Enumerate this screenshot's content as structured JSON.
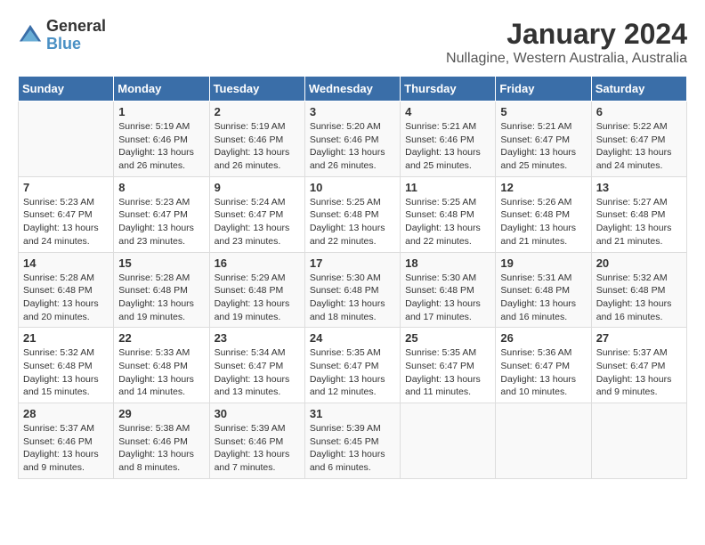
{
  "logo": {
    "text_general": "General",
    "text_blue": "Blue"
  },
  "title": "January 2024",
  "subtitle": "Nullagine, Western Australia, Australia",
  "days_of_week": [
    "Sunday",
    "Monday",
    "Tuesday",
    "Wednesday",
    "Thursday",
    "Friday",
    "Saturday"
  ],
  "weeks": [
    [
      {
        "num": "",
        "detail": ""
      },
      {
        "num": "1",
        "detail": "Sunrise: 5:19 AM\nSunset: 6:46 PM\nDaylight: 13 hours\nand 26 minutes."
      },
      {
        "num": "2",
        "detail": "Sunrise: 5:19 AM\nSunset: 6:46 PM\nDaylight: 13 hours\nand 26 minutes."
      },
      {
        "num": "3",
        "detail": "Sunrise: 5:20 AM\nSunset: 6:46 PM\nDaylight: 13 hours\nand 26 minutes."
      },
      {
        "num": "4",
        "detail": "Sunrise: 5:21 AM\nSunset: 6:46 PM\nDaylight: 13 hours\nand 25 minutes."
      },
      {
        "num": "5",
        "detail": "Sunrise: 5:21 AM\nSunset: 6:47 PM\nDaylight: 13 hours\nand 25 minutes."
      },
      {
        "num": "6",
        "detail": "Sunrise: 5:22 AM\nSunset: 6:47 PM\nDaylight: 13 hours\nand 24 minutes."
      }
    ],
    [
      {
        "num": "7",
        "detail": "Sunrise: 5:23 AM\nSunset: 6:47 PM\nDaylight: 13 hours\nand 24 minutes."
      },
      {
        "num": "8",
        "detail": "Sunrise: 5:23 AM\nSunset: 6:47 PM\nDaylight: 13 hours\nand 23 minutes."
      },
      {
        "num": "9",
        "detail": "Sunrise: 5:24 AM\nSunset: 6:47 PM\nDaylight: 13 hours\nand 23 minutes."
      },
      {
        "num": "10",
        "detail": "Sunrise: 5:25 AM\nSunset: 6:48 PM\nDaylight: 13 hours\nand 22 minutes."
      },
      {
        "num": "11",
        "detail": "Sunrise: 5:25 AM\nSunset: 6:48 PM\nDaylight: 13 hours\nand 22 minutes."
      },
      {
        "num": "12",
        "detail": "Sunrise: 5:26 AM\nSunset: 6:48 PM\nDaylight: 13 hours\nand 21 minutes."
      },
      {
        "num": "13",
        "detail": "Sunrise: 5:27 AM\nSunset: 6:48 PM\nDaylight: 13 hours\nand 21 minutes."
      }
    ],
    [
      {
        "num": "14",
        "detail": "Sunrise: 5:28 AM\nSunset: 6:48 PM\nDaylight: 13 hours\nand 20 minutes."
      },
      {
        "num": "15",
        "detail": "Sunrise: 5:28 AM\nSunset: 6:48 PM\nDaylight: 13 hours\nand 19 minutes."
      },
      {
        "num": "16",
        "detail": "Sunrise: 5:29 AM\nSunset: 6:48 PM\nDaylight: 13 hours\nand 19 minutes."
      },
      {
        "num": "17",
        "detail": "Sunrise: 5:30 AM\nSunset: 6:48 PM\nDaylight: 13 hours\nand 18 minutes."
      },
      {
        "num": "18",
        "detail": "Sunrise: 5:30 AM\nSunset: 6:48 PM\nDaylight: 13 hours\nand 17 minutes."
      },
      {
        "num": "19",
        "detail": "Sunrise: 5:31 AM\nSunset: 6:48 PM\nDaylight: 13 hours\nand 16 minutes."
      },
      {
        "num": "20",
        "detail": "Sunrise: 5:32 AM\nSunset: 6:48 PM\nDaylight: 13 hours\nand 16 minutes."
      }
    ],
    [
      {
        "num": "21",
        "detail": "Sunrise: 5:32 AM\nSunset: 6:48 PM\nDaylight: 13 hours\nand 15 minutes."
      },
      {
        "num": "22",
        "detail": "Sunrise: 5:33 AM\nSunset: 6:48 PM\nDaylight: 13 hours\nand 14 minutes."
      },
      {
        "num": "23",
        "detail": "Sunrise: 5:34 AM\nSunset: 6:47 PM\nDaylight: 13 hours\nand 13 minutes."
      },
      {
        "num": "24",
        "detail": "Sunrise: 5:35 AM\nSunset: 6:47 PM\nDaylight: 13 hours\nand 12 minutes."
      },
      {
        "num": "25",
        "detail": "Sunrise: 5:35 AM\nSunset: 6:47 PM\nDaylight: 13 hours\nand 11 minutes."
      },
      {
        "num": "26",
        "detail": "Sunrise: 5:36 AM\nSunset: 6:47 PM\nDaylight: 13 hours\nand 10 minutes."
      },
      {
        "num": "27",
        "detail": "Sunrise: 5:37 AM\nSunset: 6:47 PM\nDaylight: 13 hours\nand 9 minutes."
      }
    ],
    [
      {
        "num": "28",
        "detail": "Sunrise: 5:37 AM\nSunset: 6:46 PM\nDaylight: 13 hours\nand 9 minutes."
      },
      {
        "num": "29",
        "detail": "Sunrise: 5:38 AM\nSunset: 6:46 PM\nDaylight: 13 hours\nand 8 minutes."
      },
      {
        "num": "30",
        "detail": "Sunrise: 5:39 AM\nSunset: 6:46 PM\nDaylight: 13 hours\nand 7 minutes."
      },
      {
        "num": "31",
        "detail": "Sunrise: 5:39 AM\nSunset: 6:45 PM\nDaylight: 13 hours\nand 6 minutes."
      },
      {
        "num": "",
        "detail": ""
      },
      {
        "num": "",
        "detail": ""
      },
      {
        "num": "",
        "detail": ""
      }
    ]
  ]
}
